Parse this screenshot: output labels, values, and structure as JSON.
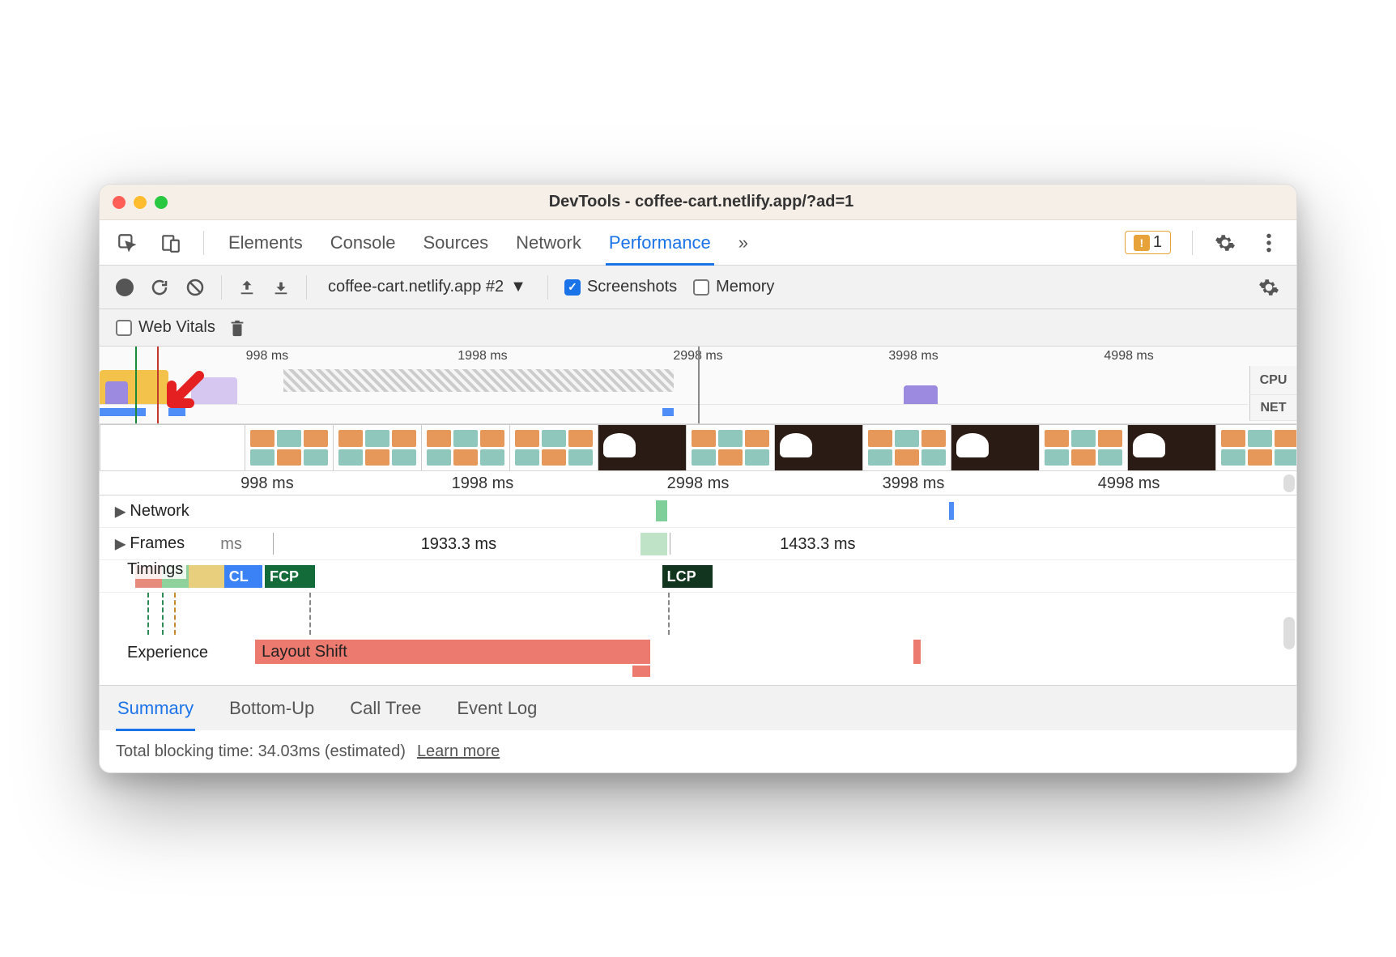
{
  "window": {
    "title": "DevTools - coffee-cart.netlify.app/?ad=1"
  },
  "tabs": {
    "items": [
      "Elements",
      "Console",
      "Sources",
      "Network",
      "Performance"
    ],
    "active": "Performance",
    "more": "»",
    "badge_count": "1"
  },
  "toolbar": {
    "profile": "coffee-cart.netlify.app #2",
    "screenshots_label": "Screenshots",
    "screenshots_checked": true,
    "memory_label": "Memory",
    "memory_checked": false
  },
  "toolbar2": {
    "web_vitals_label": "Web Vitals",
    "web_vitals_checked": false
  },
  "ruler": {
    "ticks": [
      "998 ms",
      "1998 ms",
      "2998 ms",
      "3998 ms",
      "4998 ms"
    ]
  },
  "overview_labels": {
    "cpu": "CPU",
    "net": "NET"
  },
  "tracks": {
    "network_label": "Network",
    "frames_label": "Frames",
    "frame_segments": [
      {
        "label": "ms",
        "left_pct": 8,
        "width_pct": 6
      },
      {
        "label": "1933.3 ms",
        "left_pct": 15,
        "width_pct": 30
      },
      {
        "label": "",
        "left_pct": 45.2,
        "width_pct": 2.2,
        "green": true
      },
      {
        "label": "1433.3 ms",
        "left_pct": 48,
        "width_pct": 24
      }
    ],
    "timings_label": "Timings",
    "timing_badges": [
      {
        "label": "CL",
        "left_pct": 10.4,
        "width_pct": 3.2,
        "color": "#3b82f6"
      },
      {
        "label": "FCP",
        "left_pct": 13.8,
        "width_pct": 4.2,
        "color": "#146b3a"
      },
      {
        "label": "LCP",
        "left_pct": 47.0,
        "width_pct": 4.2,
        "color": "#12351f"
      }
    ],
    "experience_label": "Experience",
    "experience_bars": [
      {
        "label": "Layout Shift",
        "left_pct": 13,
        "width_pct": 33
      },
      {
        "label": "",
        "left_pct": 68,
        "width_pct": 0.6
      }
    ]
  },
  "bottom_tabs": {
    "items": [
      "Summary",
      "Bottom-Up",
      "Call Tree",
      "Event Log"
    ],
    "active": "Summary"
  },
  "summary": {
    "tbt": "Total blocking time: 34.03ms (estimated)",
    "learn_more": "Learn more"
  }
}
